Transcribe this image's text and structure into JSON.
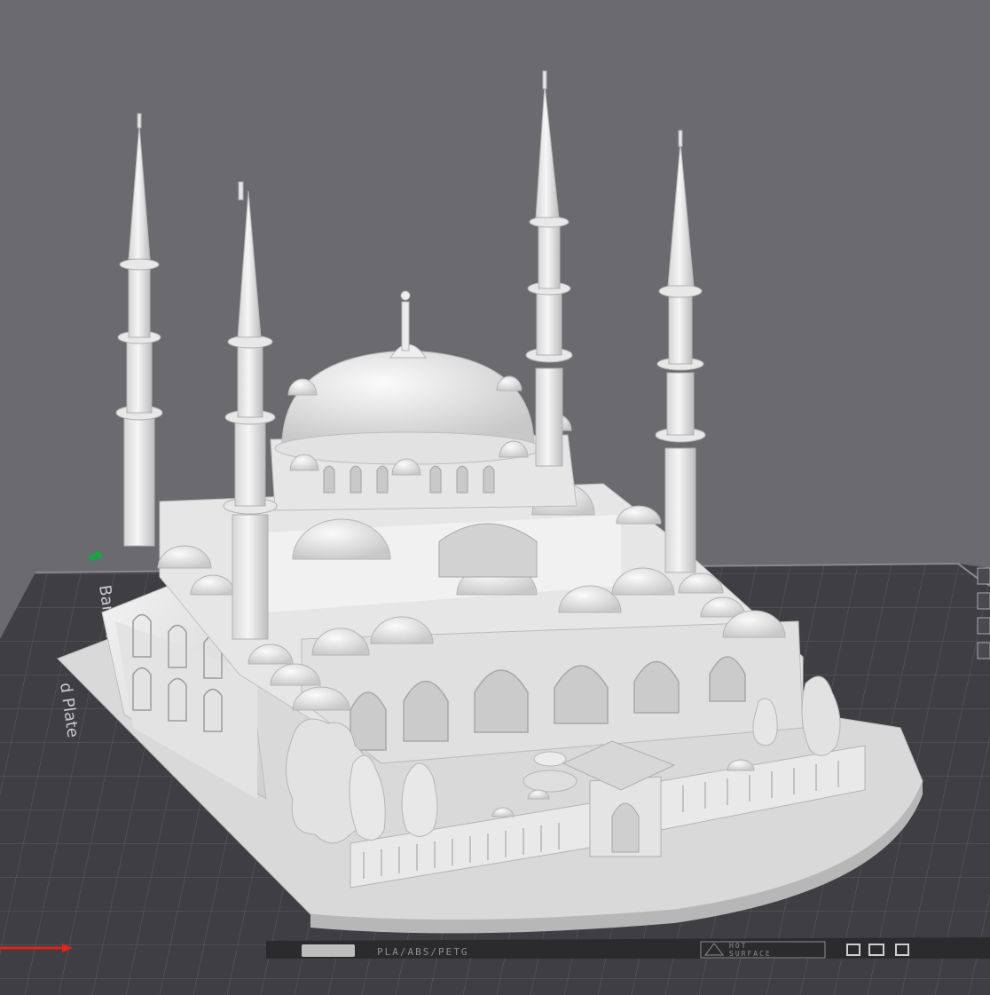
{
  "viewport": {
    "background": "#6a6a6f",
    "model": "mosque-3d-model"
  },
  "build_plate": {
    "label_line1": "Bambu Tex",
    "label_line2": "d Plate",
    "plate_color": "#3f3f43",
    "grid_color": "#56565b"
  },
  "bottom_bar": {
    "filament_label": "PLA/ABS/PETG",
    "surface_line1": "HOT",
    "surface_line2": "SURFACE"
  },
  "axes": {
    "x_color": "#e0231c",
    "y_color": "#1ea14a"
  }
}
